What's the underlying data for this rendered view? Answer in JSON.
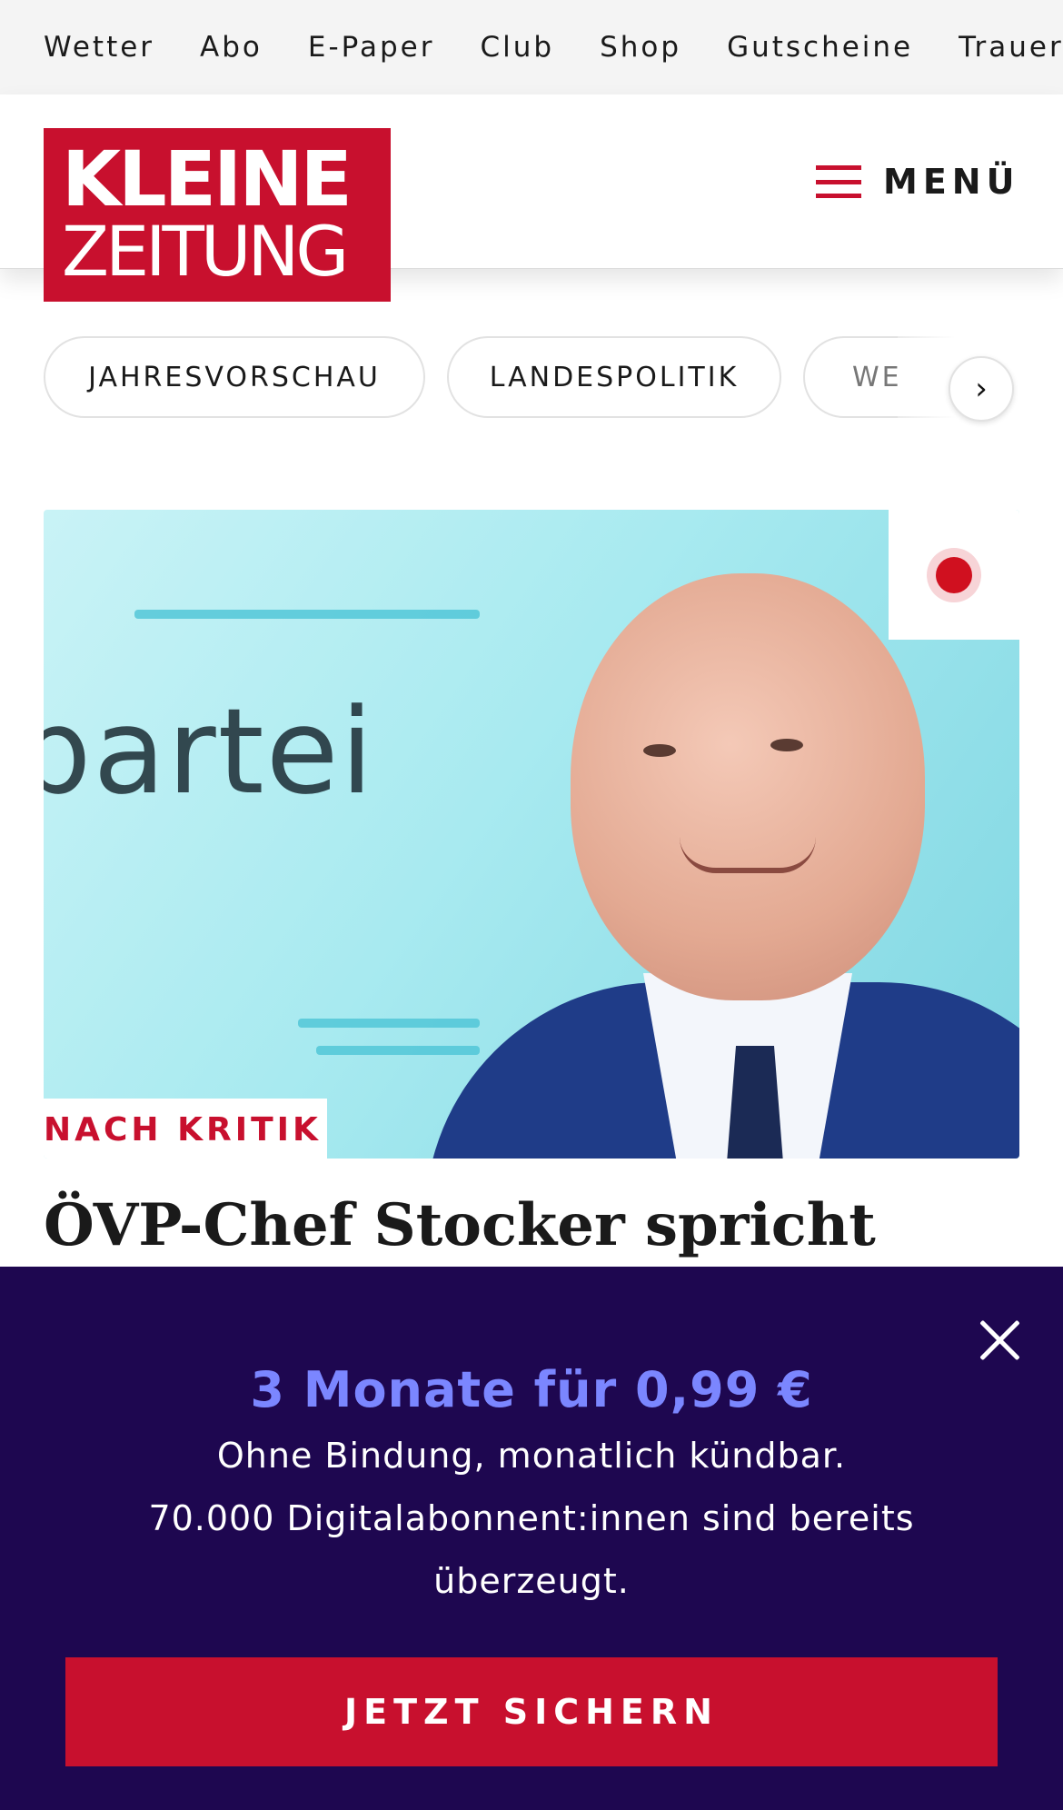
{
  "topnav": {
    "items": [
      "Wetter",
      "Abo",
      "E-Paper",
      "Club",
      "Shop",
      "Gutscheine",
      "Trauerpo"
    ]
  },
  "header": {
    "logo_line1": "KLEINE",
    "logo_line2": "ZEITUNG",
    "menu_label": "MENÜ",
    "brand_color": "#c8102e"
  },
  "tags": {
    "items": [
      "JAHRESVORSCHAU",
      "LANDESPOLITIK",
      "WE"
    ]
  },
  "article": {
    "image_text": "partei",
    "kicker": "NACH KRITIK",
    "headline": "ÖVP-Chef Stocker spricht",
    "live_indicator_color": "#d0101f"
  },
  "promo": {
    "title": "3 Monate für 0,99 €",
    "line1": "Ohne Bindung, monatlich kündbar.",
    "line2": "70.000 Digitalabonnent:innen sind bereits",
    "line3": "überzeugt.",
    "cta": "JETZT SICHERN",
    "background_color": "#1e0750",
    "title_color": "#7b86ff"
  }
}
